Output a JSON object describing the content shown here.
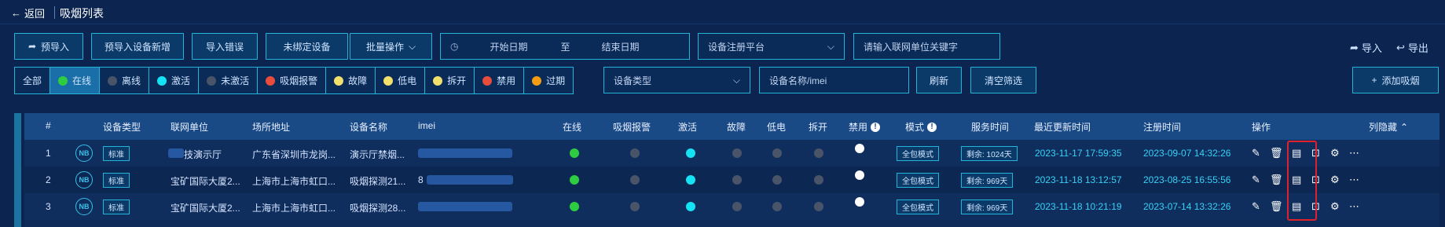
{
  "header": {
    "back_label": "返回",
    "title": "吸烟列表"
  },
  "toolbar": {
    "buttons": [
      {
        "label": "预导入",
        "icon": "share-icon"
      },
      {
        "label": "预导入设备新增"
      },
      {
        "label": "导入错误"
      },
      {
        "label": "未绑定设备"
      },
      {
        "label": "批量操作",
        "icon": "chevron-down-icon"
      }
    ],
    "date_start_placeholder": "开始日期",
    "date_to": "至",
    "date_end_placeholder": "结束日期",
    "platform_placeholder": "设备注册平台",
    "unit_keyword_placeholder": "请输入联网单位关键字",
    "import_label": "导入",
    "export_label": "导出"
  },
  "filters": {
    "chips": [
      {
        "label": "全部",
        "dot": null,
        "active": false
      },
      {
        "label": "在线",
        "dot": "#2ecc40",
        "active": true
      },
      {
        "label": "离线",
        "dot": "#4a5468",
        "active": false
      },
      {
        "label": "激活",
        "dot": "#14e3f5",
        "active": false
      },
      {
        "label": "未激活",
        "dot": "#4a5468",
        "active": false
      },
      {
        "label": "吸烟报警",
        "dot": "#e74c3c",
        "active": false
      },
      {
        "label": "故障",
        "dot": "#f1e06c",
        "active": false
      },
      {
        "label": "低电",
        "dot": "#f1e06c",
        "active": false
      },
      {
        "label": "拆开",
        "dot": "#f1e06c",
        "active": false
      },
      {
        "label": "禁用",
        "dot": "#e74c3c",
        "active": false
      },
      {
        "label": "过期",
        "dot": "#f39c12",
        "active": false
      }
    ],
    "device_type_placeholder": "设备类型",
    "device_name_placeholder": "设备名称/imei",
    "refresh_label": "刷新",
    "clear_label": "清空筛选",
    "add_label": "添加吸烟"
  },
  "table": {
    "columns": {
      "index": "#",
      "type": "设备类型",
      "unit": "联网单位",
      "address": "场所地址",
      "name": "设备名称",
      "imei": "imei",
      "online": "在线",
      "alarm": "吸烟报警",
      "active": "激活",
      "fault": "故障",
      "lowbat": "低电",
      "tamper": "拆开",
      "disabled": "禁用",
      "mode": "模式",
      "service": "服务时间",
      "updated": "最近更新时间",
      "registered": "注册时间",
      "ops": "操作",
      "hide": "列隐藏"
    },
    "rows": [
      {
        "index": "1",
        "nb": "NB",
        "type": "标准",
        "unit": "技演示厅",
        "address": "广东省深圳市龙岗...",
        "name": "演示厅禁烟...",
        "imei": "",
        "mode": "全包模式",
        "service": "剩余: 1024天",
        "updated": "2023-11-17 17:59:35",
        "registered": "2023-09-07 14:32:26"
      },
      {
        "index": "2",
        "nb": "NB",
        "type": "标准",
        "unit": "宝矿国际大厦2...",
        "address": "上海市上海市虹口...",
        "name": "吸烟探测21...",
        "imei": "8",
        "mode": "全包模式",
        "service": "剩余: 969天",
        "updated": "2023-11-18 13:12:57",
        "registered": "2023-08-25 16:55:56"
      },
      {
        "index": "3",
        "nb": "NB",
        "type": "标准",
        "unit": "宝矿国际大厦2...",
        "address": "上海市上海市虹口...",
        "name": "吸烟探测28...",
        "imei": "",
        "mode": "全包模式",
        "service": "剩余: 969天",
        "updated": "2023-11-18 10:21:19",
        "registered": "2023-07-14 13:32:26"
      }
    ],
    "status_colors": {
      "online": "#2ecc40",
      "alarm": "#4a5468",
      "active": "#14e3f5",
      "fault": "#4a5468",
      "lowbat": "#4a5468",
      "tamper": "#4a5468",
      "disabled": "#ffffff"
    }
  }
}
